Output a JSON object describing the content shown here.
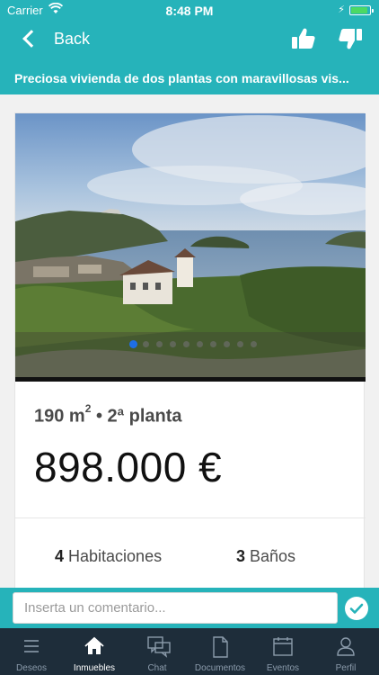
{
  "status_bar": {
    "carrier": "Carrier",
    "time": "8:48 PM",
    "battery_level": 0.9
  },
  "nav": {
    "back_label": "Back",
    "thumb_up_icon": "thumbs-up-icon",
    "thumb_down_icon": "thumbs-down-icon"
  },
  "listing": {
    "title": "Preciosa vivienda de dos plantas con maravillosas vis...",
    "area_value": "190 m",
    "area_exp": "2",
    "floor": " • 2ª planta",
    "price": "898.000 €",
    "rooms_count": "4",
    "rooms_label": "Habitaciones",
    "baths_count": "3",
    "baths_label": "Baños",
    "photo_count": 10,
    "active_photo": 1
  },
  "comment": {
    "placeholder": "Inserta un comentario..."
  },
  "tabs": [
    {
      "label": "Deseos",
      "icon": "list-icon",
      "active": false
    },
    {
      "label": "Inmuebles",
      "icon": "house-icon",
      "active": true
    },
    {
      "label": "Chat",
      "icon": "chat-icon",
      "active": false
    },
    {
      "label": "Documentos",
      "icon": "document-icon",
      "active": false
    },
    {
      "label": "Eventos",
      "icon": "calendar-icon",
      "active": false
    },
    {
      "label": "Perfil",
      "icon": "person-icon",
      "active": false
    }
  ],
  "colors": {
    "accent": "#26b3ba",
    "tabbar": "#1e2d3a",
    "active_dot": "#1e6ee6"
  }
}
